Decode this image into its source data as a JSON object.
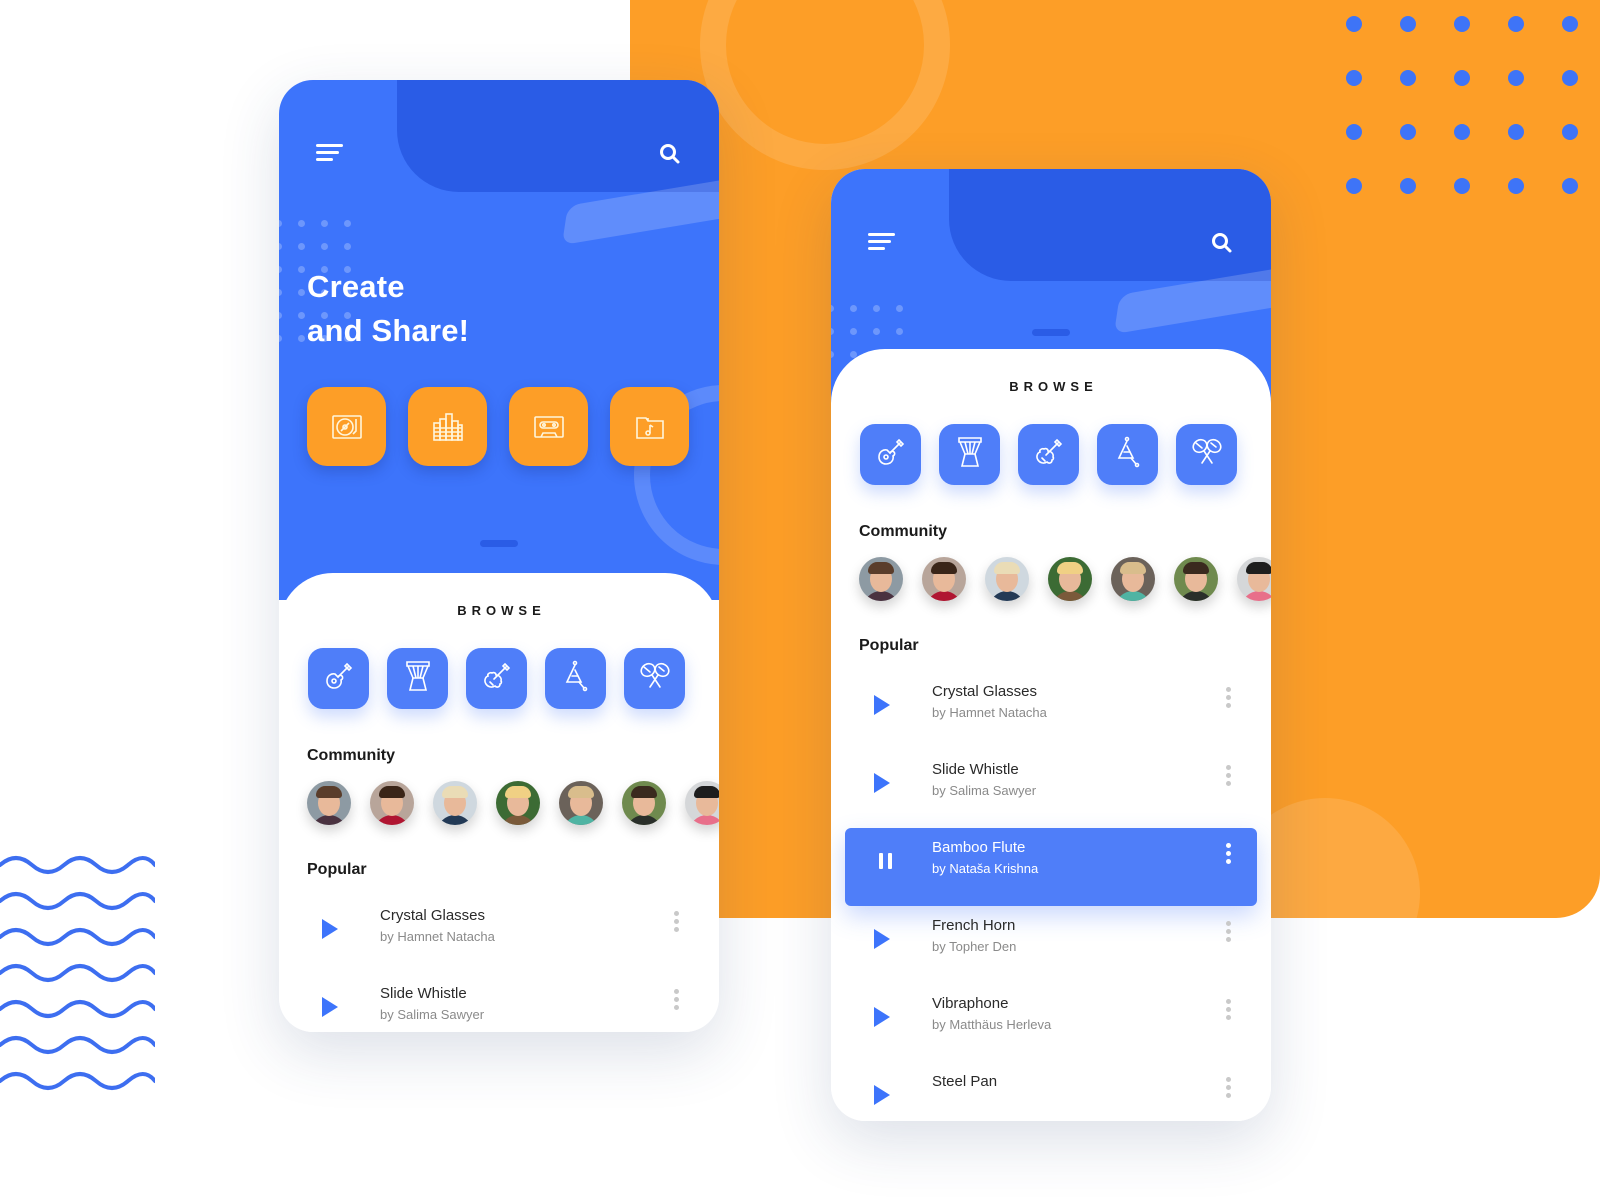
{
  "colors": {
    "primary": "#3d74fb",
    "primary_dark": "#2a5ce6",
    "accent": "#fd9e27",
    "text": "#1a1a1a",
    "muted": "#8a8a8a"
  },
  "screen_a": {
    "header": {
      "menu_icon": "menu-icon",
      "search_icon": "search-icon"
    },
    "hero_title_line1": "Create",
    "hero_title_line2": "and Share!",
    "tools": [
      {
        "icon": "turntable-icon",
        "label": "Turntable"
      },
      {
        "icon": "equalizer-icon",
        "label": "Equalizer"
      },
      {
        "icon": "cassette-icon",
        "label": "Cassette"
      },
      {
        "icon": "music-folder-icon",
        "label": "Music folder"
      }
    ],
    "browse_title": "BROWSE",
    "instruments": [
      {
        "icon": "guitar-icon"
      },
      {
        "icon": "djembe-drum-icon"
      },
      {
        "icon": "violin-icon"
      },
      {
        "icon": "triangle-icon"
      },
      {
        "icon": "maracas-icon"
      }
    ],
    "community_label": "Community",
    "popular_label": "Popular",
    "tracks": [
      {
        "title": "Crystal Glasses",
        "artist": "by Hamnet Natacha",
        "state": "play"
      },
      {
        "title": "Slide Whistle",
        "artist": "by Salima Sawyer",
        "state": "play"
      }
    ]
  },
  "screen_b": {
    "header": {
      "menu_icon": "menu-icon",
      "search_icon": "search-icon"
    },
    "browse_title": "BROWSE",
    "instruments": [
      {
        "icon": "guitar-icon"
      },
      {
        "icon": "djembe-drum-icon"
      },
      {
        "icon": "violin-icon"
      },
      {
        "icon": "triangle-icon"
      },
      {
        "icon": "maracas-icon"
      }
    ],
    "community_label": "Community",
    "popular_label": "Popular",
    "tracks": [
      {
        "title": "Crystal Glasses",
        "artist": "by Hamnet Natacha",
        "state": "play"
      },
      {
        "title": "Slide Whistle",
        "artist": "by Salima Sawyer",
        "state": "play"
      },
      {
        "title": "Bamboo Flute",
        "artist": "by Nataša Krishna",
        "state": "playing"
      },
      {
        "title": "French Horn",
        "artist": "by Topher Den",
        "state": "play"
      },
      {
        "title": "Vibraphone",
        "artist": "by Matthäus Herleva",
        "state": "play"
      },
      {
        "title": "Steel Pan",
        "artist": "",
        "state": "play"
      }
    ]
  }
}
